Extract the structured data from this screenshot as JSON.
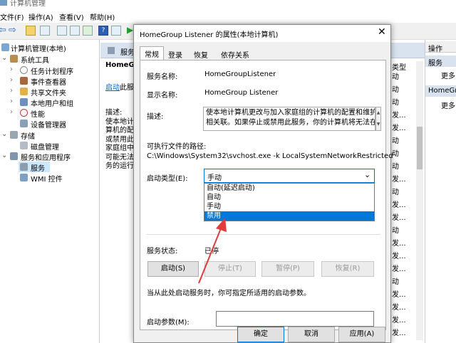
{
  "window_title": "计算机管理",
  "menu": [
    "文件(F)",
    "操作(A)",
    "查看(V)",
    "帮助(H)"
  ],
  "tree": [
    {
      "label": "计算机管理(本地)",
      "level": 0,
      "icon": "computer-icon"
    },
    {
      "label": "系统工具",
      "level": 1,
      "icon": "tools-icon"
    },
    {
      "label": "任务计划程序",
      "level": 2,
      "icon": "clock-icon"
    },
    {
      "label": "事件查看器",
      "level": 2,
      "icon": "event-viewer-icon"
    },
    {
      "label": "共享文件夹",
      "level": 2,
      "icon": "shared-folder-icon"
    },
    {
      "label": "本地用户和组",
      "level": 2,
      "icon": "users-icon"
    },
    {
      "label": "性能",
      "level": 2,
      "icon": "performance-icon"
    },
    {
      "label": "设备管理器",
      "level": 2,
      "icon": "device-manager-icon"
    },
    {
      "label": "存储",
      "level": 1,
      "icon": "storage-icon"
    },
    {
      "label": "磁盘管理",
      "level": 2,
      "icon": "disk-icon"
    },
    {
      "label": "服务和应用程序",
      "level": 1,
      "icon": "apps-icon"
    },
    {
      "label": "服务",
      "level": 2,
      "icon": "services-icon"
    },
    {
      "label": "WMI 控件",
      "level": 2,
      "icon": "wmi-icon"
    }
  ],
  "mid": {
    "header": "服务",
    "service_title": "HomeGr",
    "start_link": "启动",
    "start_link_rest": "此服务",
    "desc_lines": [
      "描述:",
      "使本地计",
      "算机的配",
      "或禁用此",
      "家庭组中",
      "可能无法",
      "务的运行"
    ],
    "col_header": "类型",
    "col_values": [
      "动",
      "动",
      "动",
      "发...",
      "发...",
      "动",
      "动",
      "动",
      "发...",
      "动",
      "发...",
      "发...",
      "动",
      "发...",
      "发...",
      "发...",
      "动",
      "发...",
      "发...",
      "发...",
      "发..."
    ]
  },
  "actions": {
    "title": "操作",
    "section1": "服务",
    "more": "更多",
    "section2": "HomeGr",
    "more2": "更多"
  },
  "dialog": {
    "title": "HomeGroup Listener 的属性(本地计算机)",
    "tabs": [
      "常规",
      "登录",
      "恢复",
      "依存关系"
    ],
    "service_name_label": "服务名称:",
    "service_name": "HomeGroupListener",
    "display_name_label": "显示名称:",
    "display_name": "HomeGroup Listener",
    "description_label": "描述:",
    "description_lines": [
      "使本地计算机更改与加入家庭组的计算机的配置和维护",
      "相关联。如果停止或禁用此服务，你的计算机将无法在"
    ],
    "exe_path_label": "可执行文件的路径:",
    "exe_path": "C:\\Windows\\System32\\svchost.exe -k LocalSystemNetworkRestricted",
    "startup_type_label": "启动类型(E):",
    "startup_type_value": "手动",
    "dropdown_options": [
      "自动(延迟启动)",
      "自动",
      "手动",
      "禁用"
    ],
    "selected_option_index": 3,
    "status_label": "服务状态:",
    "status_value": "已停",
    "buttons": {
      "start": "启动(S)",
      "stop": "停止(T)",
      "pause": "暂停(P)",
      "resume": "恢复(R)"
    },
    "hint": "当从此处启动服务时，你可指定所适用的启动参数。",
    "params_label": "启动参数(M):",
    "params_value": "",
    "ok": "确定",
    "cancel": "取消",
    "apply": "应用(A)"
  },
  "colors": {
    "accent": "#0078d7",
    "selection": "#cce8ff",
    "arrow": "#e23b3b"
  }
}
